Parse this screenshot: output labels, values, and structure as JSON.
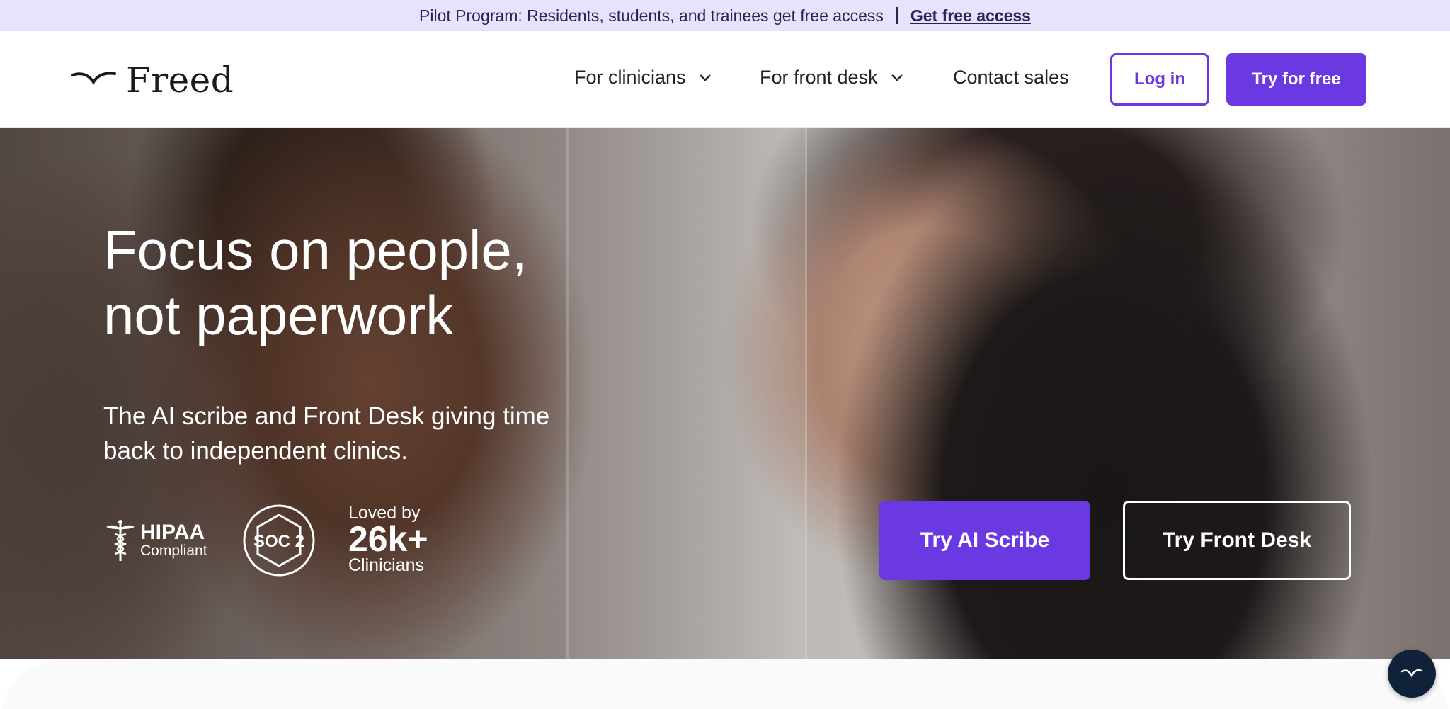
{
  "announcement": {
    "text": "Pilot Program: Residents, students, and trainees get free access",
    "link": "Get free access"
  },
  "nav": {
    "brand": "Freed",
    "items": [
      {
        "label": "For clinicians",
        "dropdown": true
      },
      {
        "label": "For front desk",
        "dropdown": true
      },
      {
        "label": "Contact sales",
        "dropdown": false
      }
    ],
    "login": "Log in",
    "try": "Try for free"
  },
  "hero": {
    "headline_line1": "Focus on people,",
    "headline_line2": "not paperwork",
    "subhead": "The AI scribe and Front Desk giving time back to independent clinics.",
    "badges": {
      "hipaa_title": "HIPAA",
      "hipaa_sub": "Compliant",
      "soc": "SOC 2",
      "loved_by": "Loved by",
      "count": "26k+",
      "clinicians": "Clinicians"
    },
    "cta_primary": "Try AI Scribe",
    "cta_secondary": "Try Front Desk"
  },
  "colors": {
    "brand_purple": "#6b39e2",
    "announce_bg": "#e9e2fd",
    "chat_fab": "#10213a"
  },
  "icons": [
    "freed-logo-icon",
    "chevron-down-icon",
    "caduceus-icon",
    "soc2-badge-icon",
    "chat-launcher-icon"
  ]
}
